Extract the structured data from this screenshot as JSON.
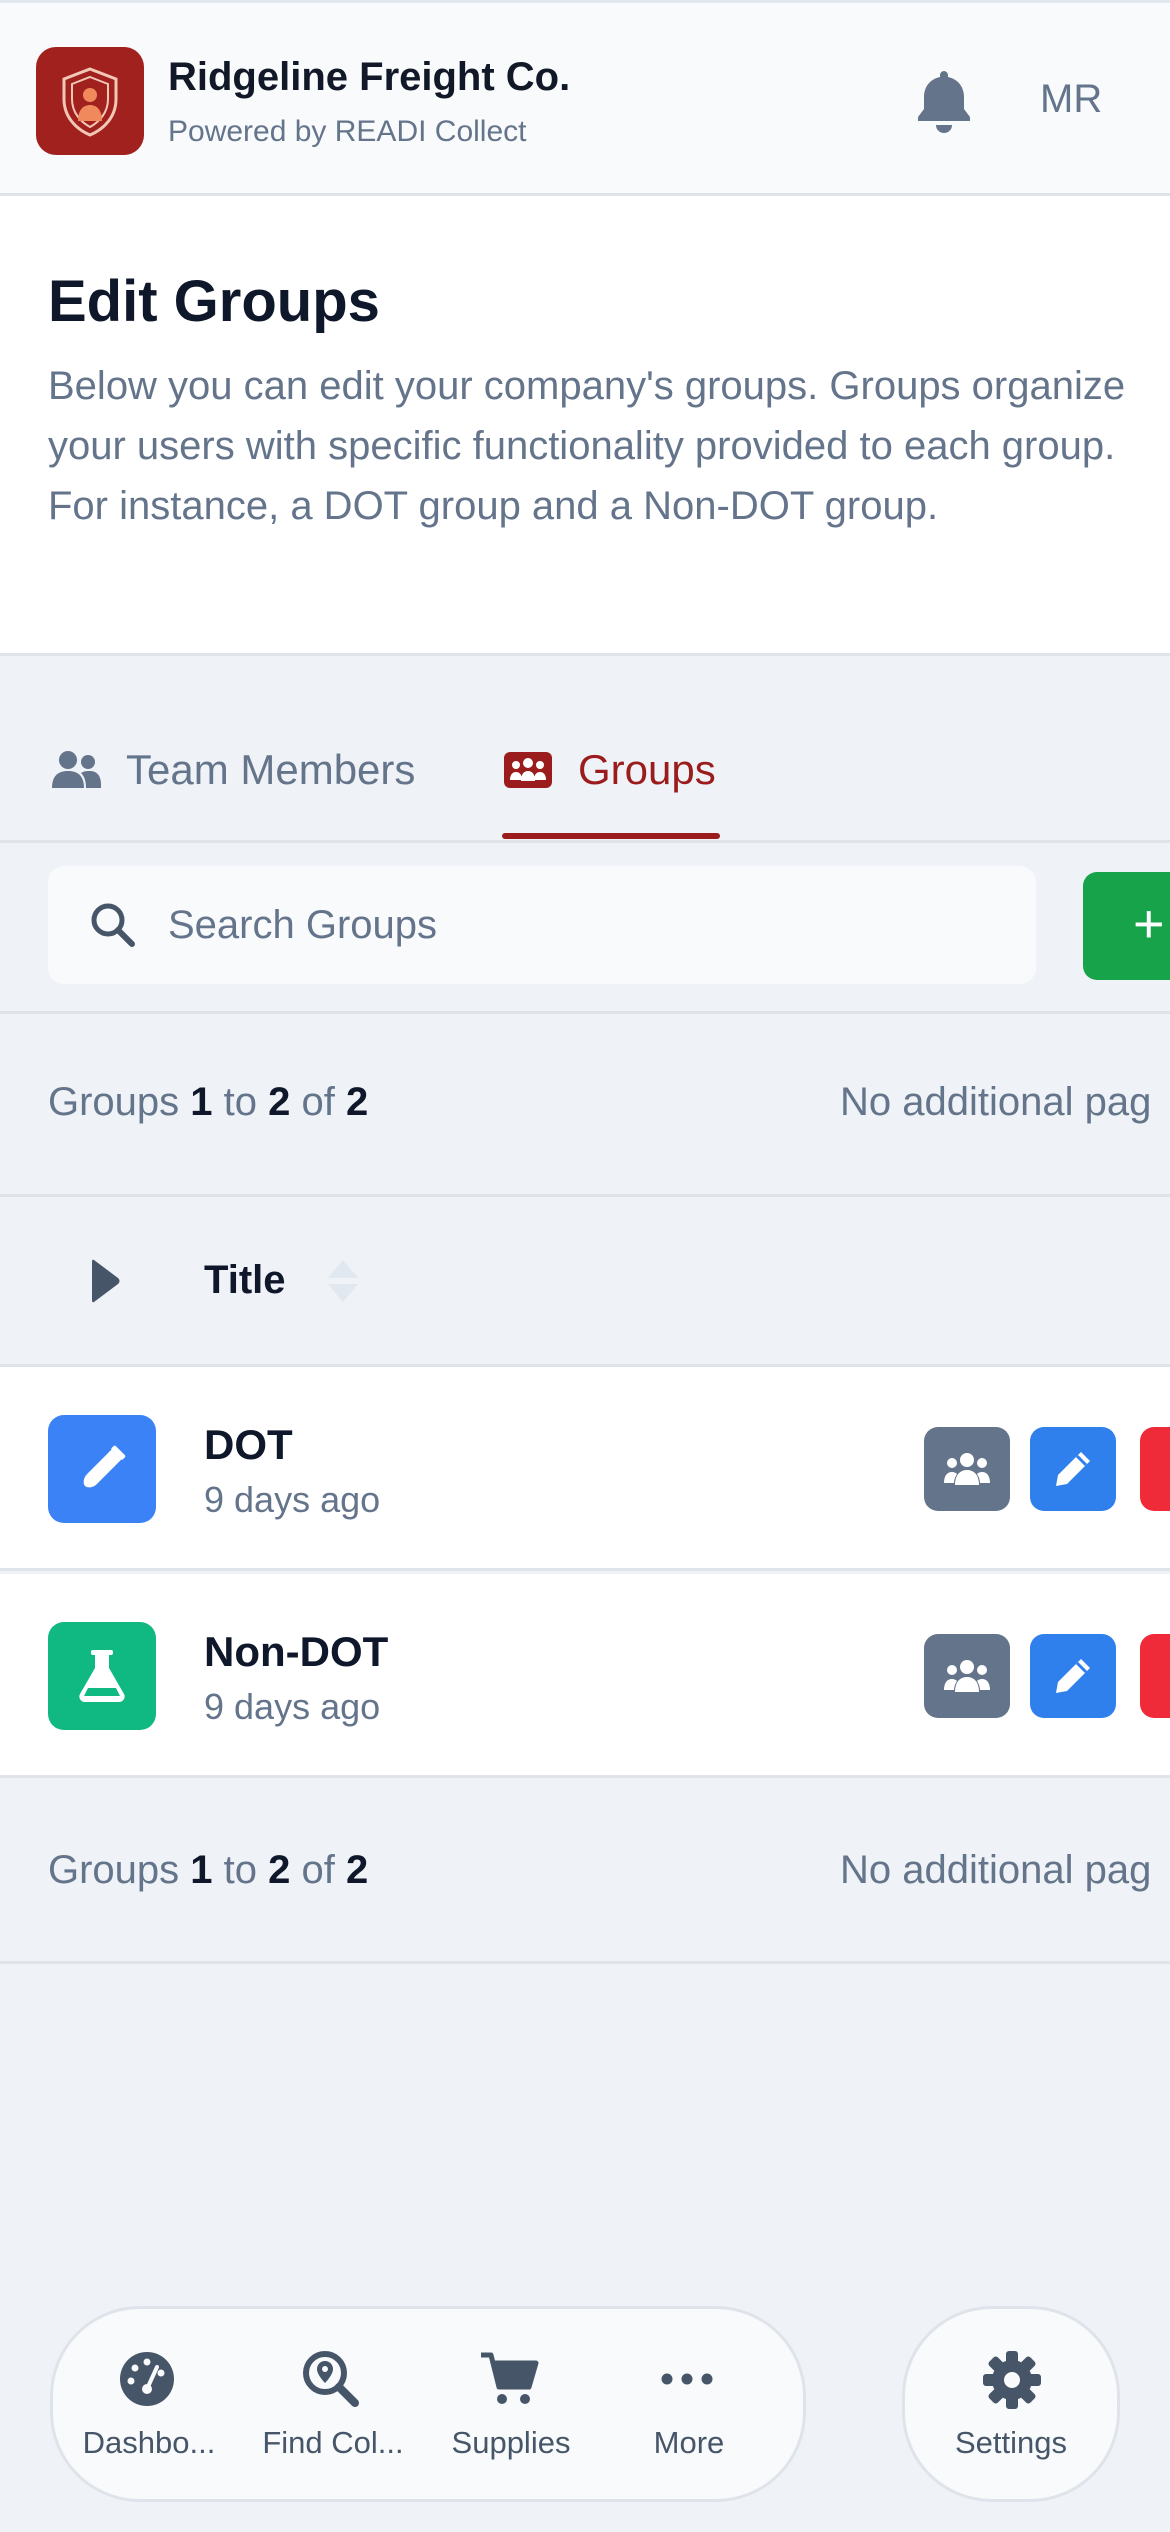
{
  "header": {
    "company_name": "Ridgeline Freight Co.",
    "powered_by": "Powered by READI Collect",
    "avatar_initials": "MR",
    "brand_color": "#a0211d"
  },
  "intro": {
    "title": "Edit Groups",
    "description": "Below you can edit your company's groups. Groups organize your users with specific functionality provided to each group. For instance, a DOT group and a Non-DOT group."
  },
  "tabs": [
    {
      "label": "Team Members",
      "icon": "users-icon",
      "active": false
    },
    {
      "label": "Groups",
      "icon": "groups-icon",
      "active": true
    }
  ],
  "search": {
    "placeholder": "Search Groups"
  },
  "add_button": {
    "label": "+"
  },
  "pagination": {
    "prefix": "Groups",
    "from": "1",
    "to_word": "to",
    "to": "2",
    "of_word": "of",
    "total": "2",
    "note": "No additional pag"
  },
  "table": {
    "column_title": "Title",
    "rows": [
      {
        "title": "DOT",
        "updated": "9 days ago",
        "icon": "test-tube-icon",
        "color": "#3b82f6"
      },
      {
        "title": "Non-DOT",
        "updated": "9 days ago",
        "icon": "flask-icon",
        "color": "#10b981"
      }
    ]
  },
  "bottom_nav": {
    "items": [
      {
        "label": "Dashbo...",
        "icon": "dashboard-icon"
      },
      {
        "label": "Find Col...",
        "icon": "find-location-icon"
      },
      {
        "label": "Supplies",
        "icon": "cart-icon"
      },
      {
        "label": "More",
        "icon": "more-icon"
      }
    ],
    "settings": {
      "label": "Settings",
      "icon": "gear-icon"
    }
  }
}
